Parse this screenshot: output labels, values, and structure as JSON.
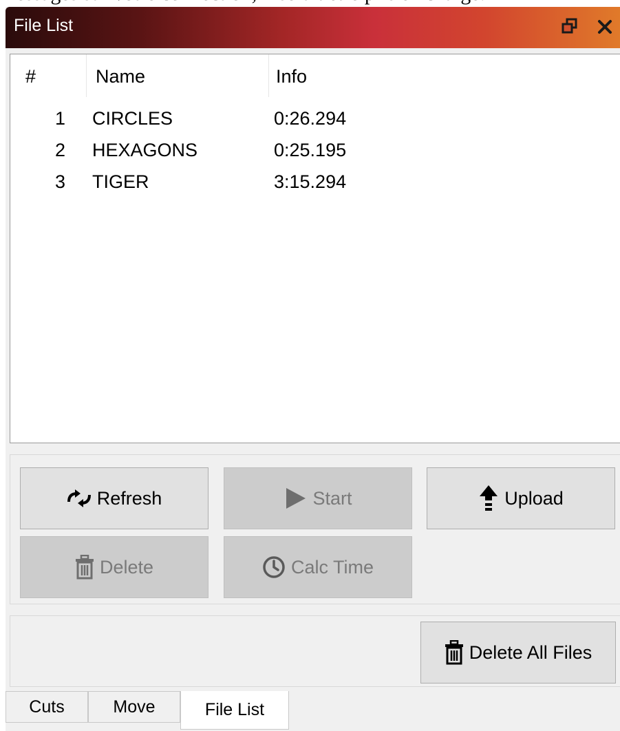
{
  "top_text": "messages sur votre connection, il serait être pris en charge.",
  "window": {
    "title": "File List",
    "float_icon": "restore-window-icon",
    "close_icon": "close-icon"
  },
  "table": {
    "headers": {
      "num": "#",
      "name": "Name",
      "info": "Info"
    },
    "rows": [
      {
        "num": "1",
        "name": "CIRCLES",
        "info": "0:26.294"
      },
      {
        "num": "2",
        "name": "HEXAGONS",
        "info": "0:25.195"
      },
      {
        "num": "3",
        "name": "TIGER",
        "info": "3:15.294"
      }
    ]
  },
  "buttons": {
    "refresh": {
      "label": "Refresh",
      "icon": "refresh-arrows-icon",
      "enabled": true
    },
    "start": {
      "label": "Start",
      "icon": "play-icon",
      "enabled": false
    },
    "upload": {
      "label": "Upload",
      "icon": "upload-arrow-icon",
      "enabled": true
    },
    "delete": {
      "label": "Delete",
      "icon": "trash-icon",
      "enabled": false
    },
    "calc_time": {
      "label": "Calc Time",
      "icon": "clock-icon",
      "enabled": false
    },
    "delete_all": {
      "label": "Delete All Files",
      "icon": "trash-icon",
      "enabled": true
    }
  },
  "tabs": [
    {
      "label": "Cuts",
      "active": false
    },
    {
      "label": "Move",
      "active": false
    },
    {
      "label": "File List",
      "active": true
    }
  ],
  "colors": {
    "titlebar_start": "#2a0b0b",
    "titlebar_mid": "#c9303a",
    "titlebar_end": "#e07a2a",
    "button_bg": "#e1e1e1",
    "button_disabled_bg": "#cccccc",
    "disabled_text": "#7a7a7a"
  }
}
